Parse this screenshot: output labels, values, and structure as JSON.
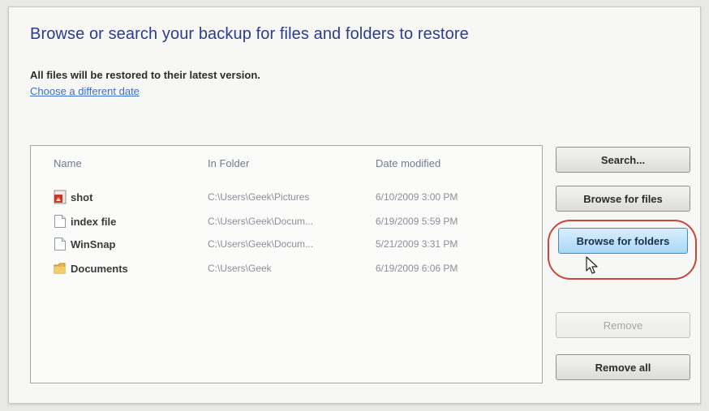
{
  "heading": "Browse or search your backup for files and folders to restore",
  "info_text": "All files will be restored to their latest version.",
  "link_text": "Choose a different date",
  "columns": {
    "name": "Name",
    "folder": "In Folder",
    "date": "Date modified"
  },
  "rows": [
    {
      "name": "shot",
      "folder": "C:\\Users\\Geek\\Pictures",
      "date": "6/10/2009 3:00 PM",
      "icon": "image-file-icon"
    },
    {
      "name": "index file",
      "folder": "C:\\Users\\Geek\\Docum...",
      "date": "6/19/2009 5:59 PM",
      "icon": "document-icon"
    },
    {
      "name": "WinSnap",
      "folder": "C:\\Users\\Geek\\Docum...",
      "date": "5/21/2009 3:31 PM",
      "icon": "document-icon"
    },
    {
      "name": "Documents",
      "folder": "C:\\Users\\Geek",
      "date": "6/19/2009 6:06 PM",
      "icon": "folder-icon"
    }
  ],
  "buttons": {
    "search": "Search...",
    "browse_files": "Browse for files",
    "browse_folders": "Browse for folders",
    "remove": "Remove",
    "remove_all": "Remove all"
  },
  "colors": {
    "heading": "#2a3d8c",
    "link": "#3a6ec8",
    "highlight_button": "#a9d8f6",
    "annotation_ring": "#c8463a"
  }
}
